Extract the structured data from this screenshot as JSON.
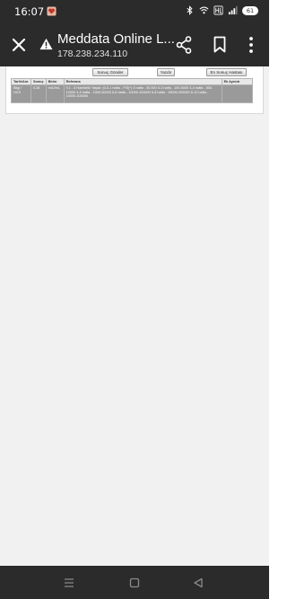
{
  "status_bar": {
    "time": "16:07",
    "battery": "61"
  },
  "toolbar": {
    "title": "Meddata Online L...",
    "url": "178.238.234.110"
  },
  "page": {
    "buttons": {
      "previous": "Sonuç Gönder",
      "print": "Yazdır",
      "first": "En Sonuç Hastası"
    },
    "table": {
      "headers": [
        "Tarih/Ara",
        "Sonuç",
        "Birim",
        "Referans",
        "Ek Ayrıntı"
      ],
      "rows": [
        {
          "date": "Bilgi / HCS",
          "status": "0.28",
          "unit": "mIU/mL",
          "reference": "0.1 - 5 Hamilelik Yaşlar: (0-0.1 hafta - FSİ(*) 3 hafta - 50.500 0-3 hafta - 100-5000 3-4 hafta - 500-10000 4-5 hafta - 1000-50000 5-6 hafta - 10000-100000 6-8 hafta - 15000-200000 8-12 hafta - 10000-100000",
          "detail": ""
        }
      ]
    }
  },
  "colors": {
    "system_bar": "#2b2b2b",
    "page_background": "#f1f1f1",
    "row_highlight": "#9a9a9a"
  }
}
